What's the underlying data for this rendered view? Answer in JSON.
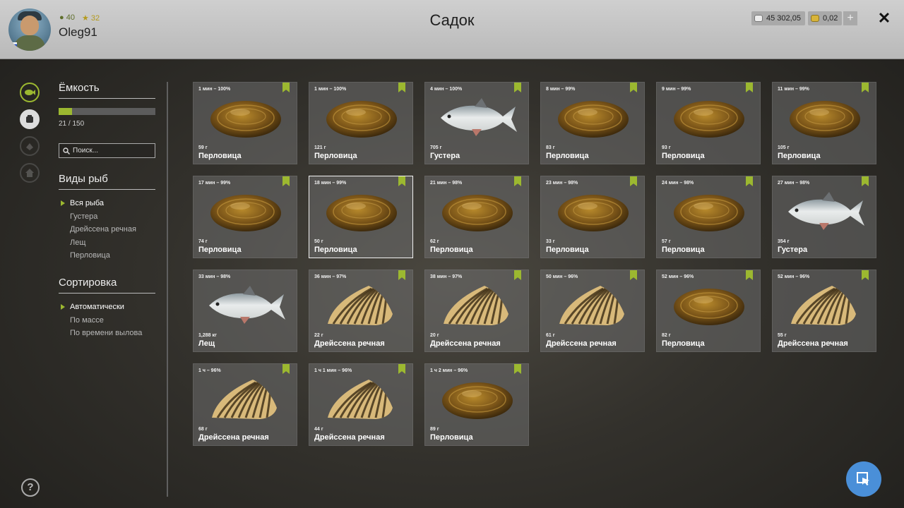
{
  "header": {
    "title": "Садок",
    "username": "Oleg91",
    "level": "40",
    "rank": "32",
    "silver": "45 302,05",
    "gold": "0,02",
    "plus_label": "+",
    "close_label": "✕"
  },
  "capacity": {
    "heading": "Ёмкость",
    "text": "21 / 150",
    "fill_percent": 14
  },
  "search": {
    "placeholder": "Поиск..."
  },
  "species": {
    "heading": "Виды рыб",
    "items": [
      {
        "label": "Вся рыба",
        "selected": true
      },
      {
        "label": "Густера",
        "selected": false
      },
      {
        "label": "Дрейссена речная",
        "selected": false
      },
      {
        "label": "Лещ",
        "selected": false
      },
      {
        "label": "Перловица",
        "selected": false
      }
    ]
  },
  "sorting": {
    "heading": "Сортировка",
    "items": [
      {
        "label": "Автоматически",
        "selected": true
      },
      {
        "label": "По массе",
        "selected": false
      },
      {
        "label": "По времени вылова",
        "selected": false
      }
    ]
  },
  "colors": {
    "accent": "#9cb830",
    "fab": "#4a8fd8"
  },
  "catches": [
    {
      "time": "1 мин – 100%",
      "mass": "59 г",
      "name": "Перловица",
      "kind": "pearl"
    },
    {
      "time": "1 мин – 100%",
      "mass": "121 г",
      "name": "Перловица",
      "kind": "pearl"
    },
    {
      "time": "4 мин – 100%",
      "mass": "705 г",
      "name": "Густера",
      "kind": "fish"
    },
    {
      "time": "8 мин – 99%",
      "mass": "83 г",
      "name": "Перловица",
      "kind": "pearl"
    },
    {
      "time": "9 мин – 99%",
      "mass": "93 г",
      "name": "Перловица",
      "kind": "pearl"
    },
    {
      "time": "11 мин – 99%",
      "mass": "105 г",
      "name": "Перловица",
      "kind": "pearl"
    },
    {
      "time": "17 мин – 99%",
      "mass": "74 г",
      "name": "Перловица",
      "kind": "pearl"
    },
    {
      "time": "18 мин – 99%",
      "mass": "50 г",
      "name": "Перловица",
      "kind": "pearl",
      "selected": true
    },
    {
      "time": "21 мин – 98%",
      "mass": "62 г",
      "name": "Перловица",
      "kind": "pearl"
    },
    {
      "time": "23 мин – 98%",
      "mass": "33 г",
      "name": "Перловица",
      "kind": "pearl"
    },
    {
      "time": "24 мин – 98%",
      "mass": "57 г",
      "name": "Перловица",
      "kind": "pearl"
    },
    {
      "time": "27 мин – 98%",
      "mass": "354 г",
      "name": "Густера",
      "kind": "fish"
    },
    {
      "time": "33 мин – 98%",
      "mass": "1,288 кг",
      "name": "Лещ",
      "kind": "fish",
      "tagless": true
    },
    {
      "time": "36 мин – 97%",
      "mass": "22 г",
      "name": "Дрейссена речная",
      "kind": "zebra"
    },
    {
      "time": "38 мин – 97%",
      "mass": "20 г",
      "name": "Дрейссена речная",
      "kind": "zebra"
    },
    {
      "time": "50 мин – 96%",
      "mass": "61 г",
      "name": "Дрейссена речная",
      "kind": "zebra"
    },
    {
      "time": "52 мин – 96%",
      "mass": "82 г",
      "name": "Перловица",
      "kind": "pearl"
    },
    {
      "time": "52 мин – 96%",
      "mass": "55 г",
      "name": "Дрейссена речная",
      "kind": "zebra"
    },
    {
      "time": "1 ч – 96%",
      "mass": "68 г",
      "name": "Дрейссена речная",
      "kind": "zebra"
    },
    {
      "time": "1 ч 1 мин – 96%",
      "mass": "44 г",
      "name": "Дрейссена речная",
      "kind": "zebra"
    },
    {
      "time": "1 ч 2 мин – 96%",
      "mass": "89 г",
      "name": "Перловица",
      "kind": "pearl"
    }
  ]
}
